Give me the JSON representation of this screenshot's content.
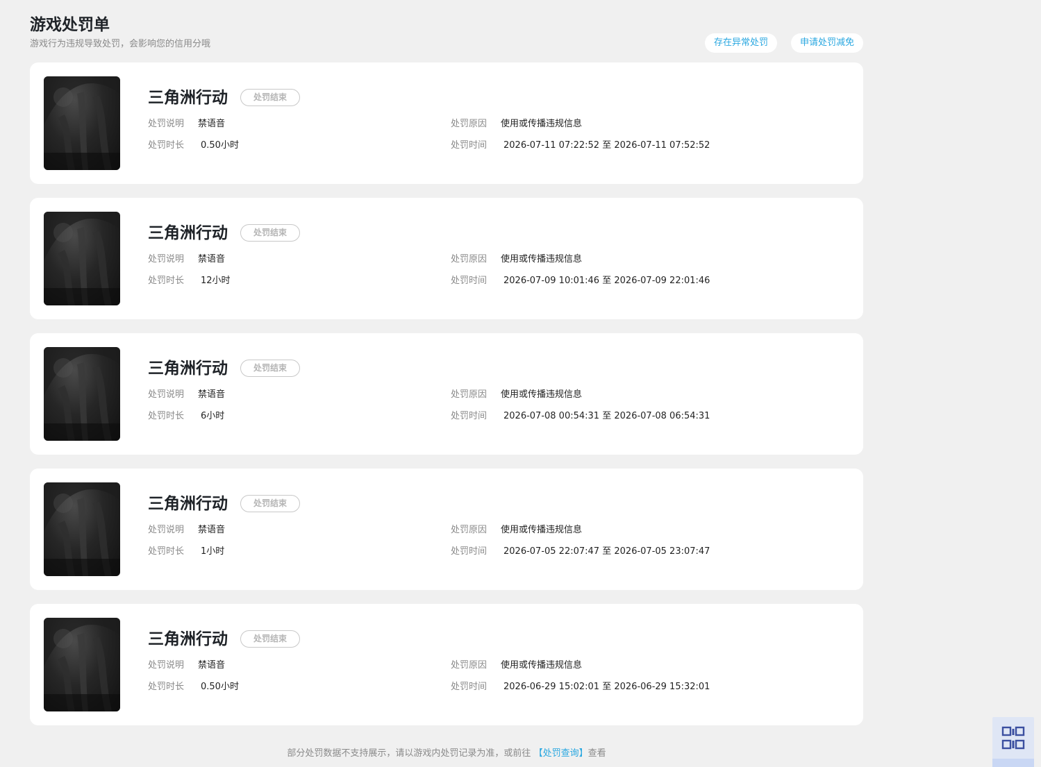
{
  "header": {
    "title": "游戏处罚单",
    "subtitle": "游戏行为违规导致处罚，会影响您的信用分哦",
    "actions": [
      "存在异常处罚",
      "申请处罚减免"
    ]
  },
  "labels": {
    "description": "处罚说明",
    "duration": "处罚时长",
    "reason": "处罚原因",
    "time": "处罚时间",
    "range_sep": "至"
  },
  "records": [
    {
      "game": "三角洲行动",
      "status": "处罚结束",
      "description": "禁语音",
      "duration": "0.50小时",
      "reason": "使用或传播违规信息",
      "start": "2026-07-11 07:22:52",
      "end": "2026-07-11 07:52:52"
    },
    {
      "game": "三角洲行动",
      "status": "处罚结束",
      "description": "禁语音",
      "duration": "12小时",
      "reason": "使用或传播违规信息",
      "start": "2026-07-09 10:01:46",
      "end": "2026-07-09 22:01:46"
    },
    {
      "game": "三角洲行动",
      "status": "处罚结束",
      "description": "禁语音",
      "duration": "6小时",
      "reason": "使用或传播违规信息",
      "start": "2026-07-08 00:54:31",
      "end": "2026-07-08 06:54:31"
    },
    {
      "game": "三角洲行动",
      "status": "处罚结束",
      "description": "禁语音",
      "duration": "1小时",
      "reason": "使用或传播违规信息",
      "start": "2026-07-05 22:07:47",
      "end": "2026-07-05 23:07:47"
    },
    {
      "game": "三角洲行动",
      "status": "处罚结束",
      "description": "禁语音",
      "duration": "0.50小时",
      "reason": "使用或传播违规信息",
      "start": "2026-06-29 15:02:01",
      "end": "2026-06-29 15:32:01"
    }
  ],
  "footer": {
    "prefix": "部分处罚数据不支持展示，请以游戏内处罚记录为准，或前往",
    "link": "【处罚查询】",
    "suffix": "查看"
  },
  "icons": {
    "qr": "qr-code-icon",
    "thumbnail": "game-cover-image"
  },
  "colors": {
    "accent": "#29a7e0",
    "background": "#f0f0f0",
    "muted": "#8a8a8a"
  }
}
